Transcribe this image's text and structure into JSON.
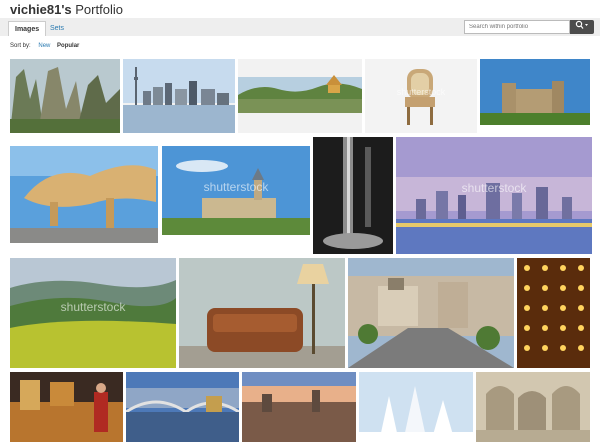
{
  "header": {
    "username": "vichie81's",
    "title_suffix": "Portfolio"
  },
  "tabs": [
    {
      "label": "Images",
      "active": true
    },
    {
      "label": "Sets",
      "active": false
    }
  ],
  "search": {
    "placeholder": "Search within portfolio",
    "button_icon": "search-icon"
  },
  "sort": {
    "label": "Sort by:",
    "options": [
      "New",
      "Popular"
    ],
    "selected": "Popular"
  },
  "watermark": "shutterstock",
  "thumbnails": [
    {
      "subject": "karst-mountains"
    },
    {
      "subject": "toronto-skyline"
    },
    {
      "subject": "lake-pagoda"
    },
    {
      "subject": "antique-chair"
    },
    {
      "subject": "castle-hill"
    },
    {
      "subject": "metropol-parasol"
    },
    {
      "subject": "castle-blue-sky"
    },
    {
      "subject": "waterfall-bw"
    },
    {
      "subject": "city-skyline-dusk"
    },
    {
      "subject": "green-valley"
    },
    {
      "subject": "leather-sofa-lamp"
    },
    {
      "subject": "madrid-street"
    },
    {
      "subject": "golden-lights"
    },
    {
      "subject": "market-stall"
    },
    {
      "subject": "bridge-city"
    },
    {
      "subject": "old-town-dusk"
    },
    {
      "subject": "snowy-trees"
    },
    {
      "subject": "cloister-corridor"
    }
  ]
}
